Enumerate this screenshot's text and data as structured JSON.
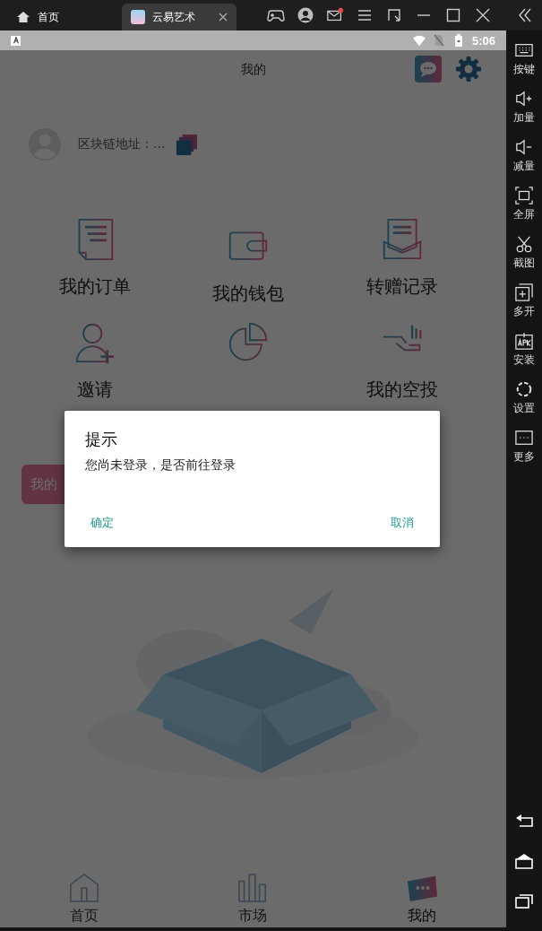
{
  "emulator_tabs": [
    {
      "label": "首页",
      "selected": false
    },
    {
      "label": "云易艺术",
      "selected": true
    }
  ],
  "mail_badge": true,
  "status_bar": {
    "time": "5:06"
  },
  "header": {
    "title": "我的"
  },
  "profile": {
    "address_label": "区块链地址：..."
  },
  "menu_items": [
    {
      "kind": "order",
      "label": "我的订单"
    },
    {
      "kind": "wallet",
      "label": "我的钱包"
    },
    {
      "kind": "transfer",
      "label": "转赠记录"
    },
    {
      "kind": "invite",
      "label": "邀请"
    },
    {
      "kind": "pie"
    },
    {
      "kind": "airdrop",
      "label": "我的空投"
    }
  ],
  "action_button": {
    "label": "我的"
  },
  "dialog": {
    "title": "提示",
    "message": "您尚未登录，是否前往登录",
    "buttons": [
      {
        "label": "确定"
      },
      {
        "label": "取消"
      }
    ]
  },
  "bottom_nav": [
    {
      "kind": "home",
      "label": "首页",
      "selected": false
    },
    {
      "kind": "market",
      "label": "市场",
      "selected": false
    },
    {
      "kind": "mine",
      "label": "我的",
      "selected": true
    }
  ],
  "sidebar": [
    {
      "kind": "keyboard",
      "label": "按键"
    },
    {
      "kind": "vol-up",
      "label": "加量"
    },
    {
      "kind": "vol-down",
      "label": "减量"
    },
    {
      "kind": "fullscreen",
      "label": "全屏"
    },
    {
      "kind": "screenshot",
      "label": "截图"
    },
    {
      "kind": "multi",
      "label": "多开"
    },
    {
      "kind": "apk",
      "label": "安装"
    },
    {
      "kind": "settings",
      "label": "设置"
    },
    {
      "kind": "more",
      "label": "更多"
    }
  ]
}
